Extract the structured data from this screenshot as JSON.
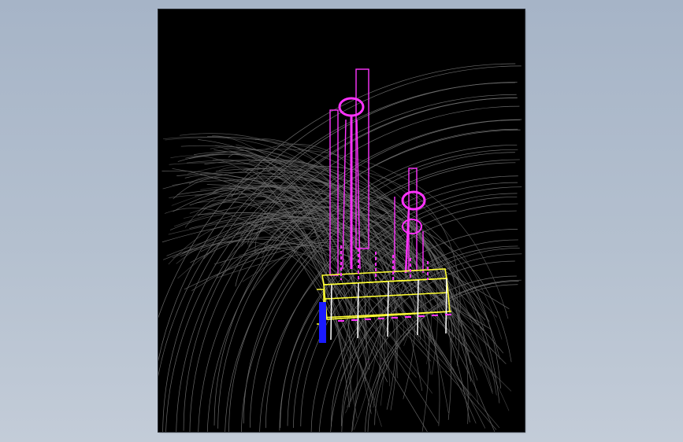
{
  "canvas": {
    "background": "#000000",
    "frame_color": "#a6b4c7"
  },
  "layers": {
    "arc_color": "#6a6a6a",
    "frame_color": "#ff33ff",
    "platform_color": "#ffff33",
    "column_color": "#ffffff",
    "support_color": "#1a1aff"
  }
}
